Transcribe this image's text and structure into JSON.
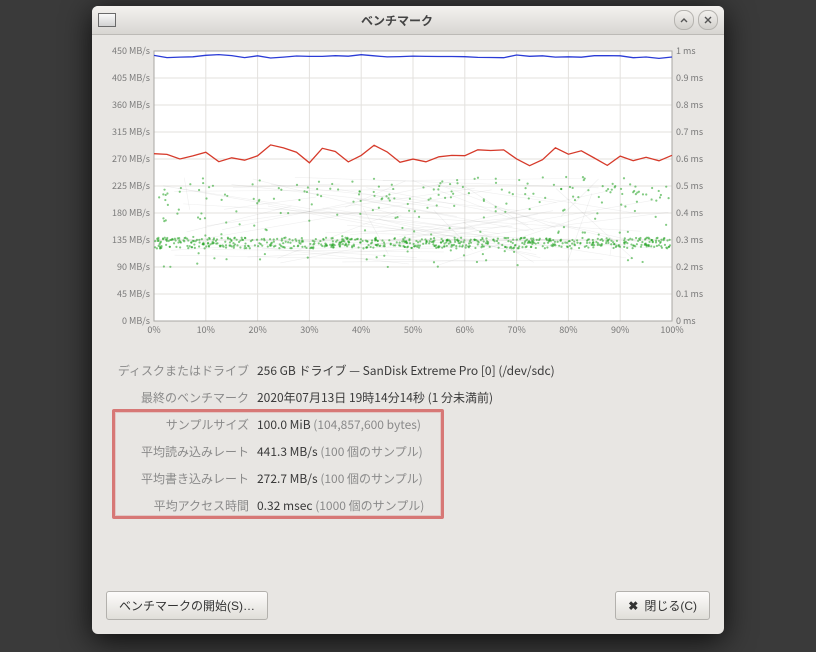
{
  "window": {
    "title": "ベンチマーク"
  },
  "chart_data": {
    "type": "line",
    "xlabel": "",
    "ylabel_left": "MB/s",
    "ylabel_right": "ms",
    "xlim": [
      0,
      100
    ],
    "ylim_left": [
      0,
      450
    ],
    "ylim_right": [
      0,
      1
    ],
    "x_ticks": [
      "0%",
      "10%",
      "20%",
      "30%",
      "40%",
      "50%",
      "60%",
      "70%",
      "80%",
      "90%",
      "100%"
    ],
    "y_left_ticks": [
      "0 MB/s",
      "45 MB/s",
      "90 MB/s",
      "135 MB/s",
      "180 MB/s",
      "225 MB/s",
      "270 MB/s",
      "315 MB/s",
      "360 MB/s",
      "405 MB/s",
      "450 MB/s"
    ],
    "y_right_ticks": [
      "0 ms",
      "0.1 ms",
      "0.2 ms",
      "0.3 ms",
      "0.4 ms",
      "0.5 ms",
      "0.6 ms",
      "0.7 ms",
      "0.8 ms",
      "0.9 ms",
      "1 ms"
    ],
    "series": [
      {
        "name": "read",
        "color": "#2a3bd6",
        "x": [
          0,
          5,
          10,
          15,
          20,
          25,
          30,
          35,
          40,
          45,
          50,
          55,
          60,
          65,
          70,
          75,
          80,
          85,
          90,
          95,
          100
        ],
        "values": [
          441,
          440,
          443,
          442,
          441,
          440,
          442,
          441,
          443,
          440,
          441,
          442,
          441,
          440,
          442,
          441,
          440,
          442,
          441,
          439,
          441
        ]
      },
      {
        "name": "write",
        "color": "#d63a2a",
        "x": [
          0,
          5,
          10,
          15,
          20,
          25,
          30,
          35,
          40,
          45,
          50,
          55,
          60,
          65,
          70,
          75,
          80,
          85,
          90,
          95,
          100
        ],
        "values": [
          275,
          268,
          280,
          272,
          278,
          290,
          265,
          282,
          274,
          288,
          270,
          280,
          272,
          285,
          268,
          278,
          270,
          276,
          272,
          280,
          272
        ]
      },
      {
        "name": "access_time",
        "color": "#2aa82a",
        "x": [
          0,
          5,
          10,
          15,
          20,
          25,
          30,
          35,
          40,
          45,
          50,
          55,
          60,
          65,
          70,
          75,
          80,
          85,
          90,
          95,
          100
        ],
        "values": [
          0.3,
          0.31,
          0.3,
          0.32,
          0.31,
          0.3,
          0.33,
          0.3,
          0.31,
          0.32,
          0.3,
          0.31,
          0.3,
          0.32,
          0.31,
          0.3,
          0.31,
          0.3,
          0.32,
          0.31,
          0.3
        ],
        "axis": "right"
      }
    ],
    "scatter_band_y_range": [
      90,
      230
    ],
    "scatter_main_y": 135
  },
  "info": {
    "disk_label": "ディスクまたはドライブ",
    "disk_value": "256 GB ドライブ — SanDisk Extreme Pro [0] (/dev/sdc)",
    "last_label": "最終のベンチマーク",
    "last_value": "2020年07月13日 19時14分14秒 (1 分未満前)",
    "sample_label": "サンプルサイズ",
    "sample_value": "100.0 MiB ",
    "sample_sub": "(104,857,600 bytes)",
    "read_label": "平均読み込みレート",
    "read_value": "441.3 MB/s ",
    "read_sub": "(100 個のサンプル)",
    "write_label": "平均書き込みレート",
    "write_value": "272.7 MB/s ",
    "write_sub": "(100 個のサンプル)",
    "access_label": "平均アクセス時間",
    "access_value": "0.32 msec ",
    "access_sub": "(1000 個のサンプル)"
  },
  "buttons": {
    "start": "ベンチマークの開始(S)…",
    "close": "閉じる(C)"
  }
}
